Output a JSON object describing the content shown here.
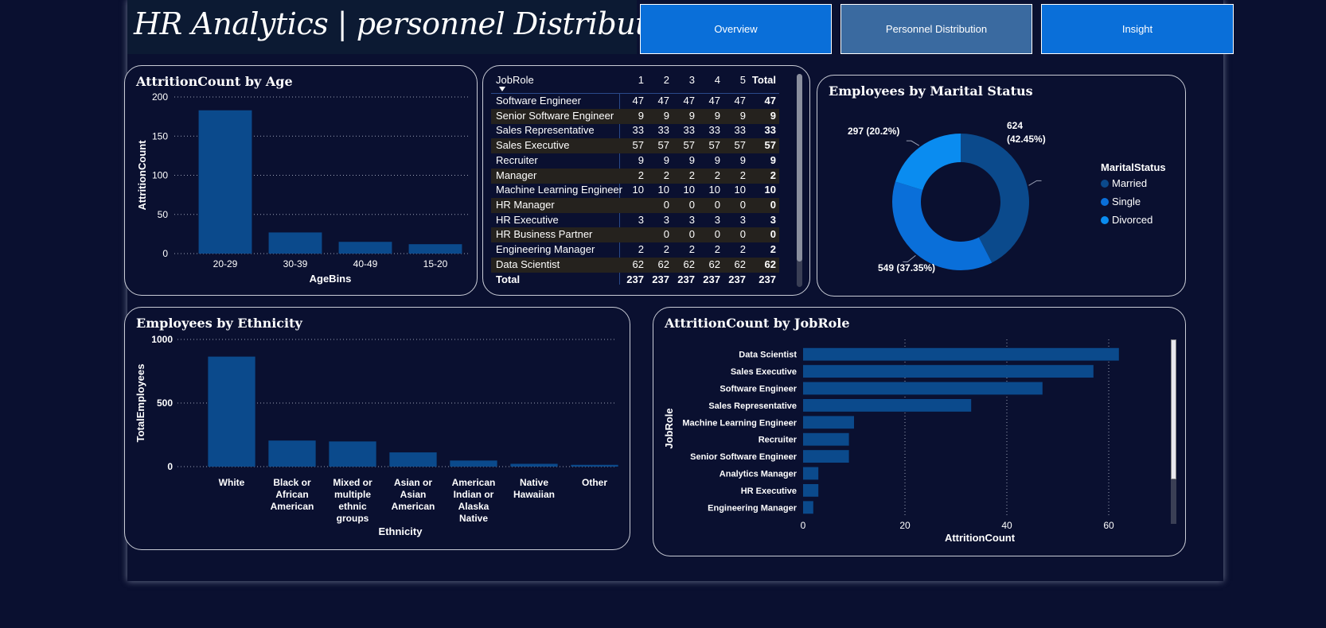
{
  "header": {
    "title": "HR Analytics | personnel Distribution"
  },
  "nav": {
    "overview": "Overview",
    "personnel": "Personnel Distribution",
    "insight": "Insight"
  },
  "colors": {
    "bar": "#0b4a8c",
    "married": "#0b4a8c",
    "single": "#0a6fd9",
    "divorced": "#0a8cf0",
    "accent": "#0a6fd9"
  },
  "age_chart": {
    "title": "AttritionCount by Age",
    "chart_data": {
      "type": "bar",
      "categories": [
        "20-29",
        "30-39",
        "40-49",
        "15-20"
      ],
      "values": [
        183,
        27,
        15,
        12
      ],
      "ylim": [
        0,
        200
      ],
      "yticks": [
        0,
        50,
        100,
        150,
        200
      ],
      "xlabel": "AgeBins",
      "ylabel": "AttritionCount"
    }
  },
  "jobrole_table": {
    "columns": [
      "JobRole",
      "1",
      "2",
      "3",
      "4",
      "5",
      "Total"
    ],
    "rows": [
      {
        "name": "Software Engineer",
        "v": [
          "47",
          "47",
          "47",
          "47",
          "47"
        ],
        "total": "47"
      },
      {
        "name": "Senior Software Engineer",
        "v": [
          "9",
          "9",
          "9",
          "9",
          "9"
        ],
        "total": "9"
      },
      {
        "name": "Sales Representative",
        "v": [
          "33",
          "33",
          "33",
          "33",
          "33"
        ],
        "total": "33"
      },
      {
        "name": "Sales Executive",
        "v": [
          "57",
          "57",
          "57",
          "57",
          "57"
        ],
        "total": "57"
      },
      {
        "name": "Recruiter",
        "v": [
          "9",
          "9",
          "9",
          "9",
          "9"
        ],
        "total": "9"
      },
      {
        "name": "Manager",
        "v": [
          "2",
          "2",
          "2",
          "2",
          "2"
        ],
        "total": "2"
      },
      {
        "name": "Machine Learning Engineer",
        "v": [
          "10",
          "10",
          "10",
          "10",
          "10"
        ],
        "total": "10"
      },
      {
        "name": "HR Manager",
        "v": [
          "",
          "0",
          "0",
          "0",
          "0"
        ],
        "total": "0"
      },
      {
        "name": "HR Executive",
        "v": [
          "3",
          "3",
          "3",
          "3",
          "3"
        ],
        "total": "3"
      },
      {
        "name": "HR Business Partner",
        "v": [
          "",
          "0",
          "0",
          "0",
          "0"
        ],
        "total": "0"
      },
      {
        "name": "Engineering Manager",
        "v": [
          "2",
          "2",
          "2",
          "2",
          "2"
        ],
        "total": "2"
      },
      {
        "name": "Data Scientist",
        "v": [
          "62",
          "62",
          "62",
          "62",
          "62"
        ],
        "total": "62"
      }
    ],
    "total_row": {
      "label": "Total",
      "v": [
        "237",
        "237",
        "237",
        "237",
        "237"
      ],
      "total": "237"
    }
  },
  "marital_chart": {
    "title": "Employees by Marital Status",
    "legend_title": "MaritalStatus",
    "chart_data": {
      "type": "pie",
      "series": [
        {
          "name": "Married",
          "value": 624,
          "pct": "42.45%",
          "label_line1": "624",
          "label_line2": "(42.45%)"
        },
        {
          "name": "Single",
          "value": 549,
          "pct": "37.35%",
          "label": "549 (37.35%)"
        },
        {
          "name": "Divorced",
          "value": 297,
          "pct": "20.2%",
          "label": "297 (20.2%)"
        }
      ],
      "legend_placement": "right"
    }
  },
  "ethnicity_chart": {
    "title": "Employees by Ethnicity",
    "chart_data": {
      "type": "bar",
      "categories": [
        [
          "White"
        ],
        [
          "Black or",
          "African",
          "American"
        ],
        [
          "Mixed or",
          "multiple",
          "ethnic",
          "groups"
        ],
        [
          "Asian or",
          "Asian",
          "American"
        ],
        [
          "American",
          "Indian or",
          "Alaska",
          "Native"
        ],
        [
          "Native",
          "Hawaiian"
        ],
        [
          "Other"
        ]
      ],
      "values": [
        865,
        205,
        198,
        112,
        48,
        22,
        14
      ],
      "ylim": [
        0,
        1000
      ],
      "yticks": [
        0,
        500,
        1000
      ],
      "xlabel": "Ethnicity",
      "ylabel": "TotalEmployees"
    }
  },
  "jobrole_chart": {
    "title": "AttritionCount by JobRole",
    "chart_data": {
      "type": "bar",
      "orientation": "horizontal",
      "categories": [
        "Data Scientist",
        "Sales Executive",
        "Software Engineer",
        "Sales Representative",
        "Machine Learning Engineer",
        "Recruiter",
        "Senior Software Engineer",
        "Analytics Manager",
        "HR Executive",
        "Engineering Manager"
      ],
      "values": [
        62,
        57,
        47,
        33,
        10,
        9,
        9,
        3,
        3,
        2
      ],
      "xlim": [
        0,
        70
      ],
      "xticks": [
        0,
        20,
        40,
        60
      ],
      "xlabel": "AttritionCount",
      "ylabel": "JobRole"
    }
  }
}
